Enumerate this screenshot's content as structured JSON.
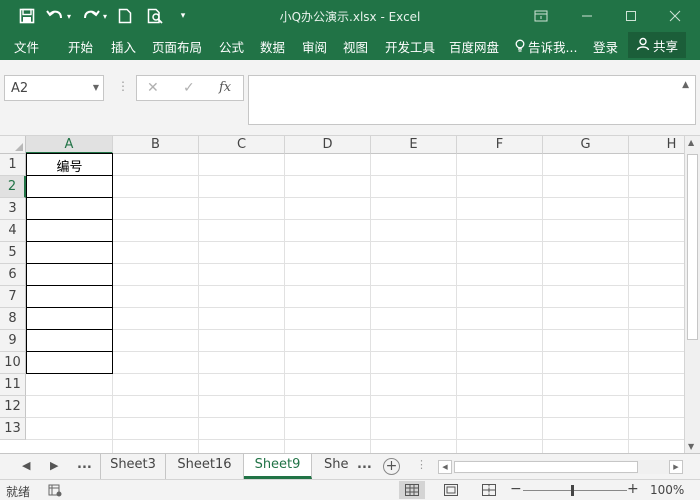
{
  "titlebar": {
    "title": "小Q办公演示.xlsx - Excel",
    "qa_icons": [
      "save-icon",
      "undo-icon",
      "redo-icon",
      "new-file-icon",
      "print-preview-icon",
      "customize-toolbar-icon"
    ],
    "window_buttons": [
      "ribbon-display-options-icon",
      "minimize-icon",
      "restore-icon",
      "close-icon"
    ]
  },
  "ribbon": {
    "tabs": [
      "文件",
      "开始",
      "插入",
      "页面布局",
      "公式",
      "数据",
      "审阅",
      "视图",
      "开发工具",
      "百度网盘",
      "告诉我...",
      "登录"
    ],
    "share_label": "共享"
  },
  "formula_bar": {
    "name_box": "A2",
    "fx_label": "fx",
    "value": ""
  },
  "grid": {
    "columns": [
      "A",
      "B",
      "C",
      "D",
      "E",
      "F",
      "G",
      "H"
    ],
    "selected_column": "A",
    "rows": [
      "1",
      "2",
      "3",
      "4",
      "5",
      "6",
      "7",
      "8",
      "9",
      "10",
      "11",
      "12",
      "13"
    ],
    "selected_row": "2",
    "cells": {
      "A1": "编号"
    }
  },
  "sheet_tabs": {
    "ellipsis": "...",
    "tabs": [
      "Sheet3",
      "Sheet16",
      "Sheet9",
      "Shee"
    ],
    "more": "...",
    "active": "Sheet9"
  },
  "status_bar": {
    "ready": "就绪",
    "zoom": "100%",
    "zoom_minus": "−",
    "zoom_plus": "+"
  }
}
